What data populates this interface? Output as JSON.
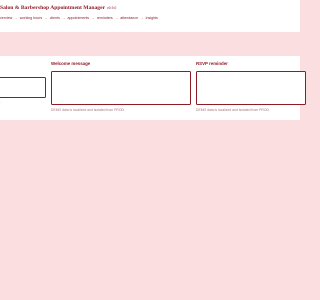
{
  "app": {
    "title": "Salon & Barbershop Appointment Manager",
    "version": "v0.9.0"
  },
  "nav": {
    "items": [
      "verview",
      "working hours",
      "clients",
      "appointments",
      "reminders",
      "attendance",
      "insights"
    ],
    "separator": "→"
  },
  "form": {
    "left_field": {
      "hint": "."
    },
    "welcome": {
      "label": "Welcome message",
      "value": "",
      "hint": "DEMO data is localized and isolated from PROD."
    },
    "rsvp": {
      "label": "RSVP reminder",
      "value": "",
      "hint": "DEMO data is localized and isolated from PROD."
    }
  },
  "colors": {
    "background": "#fbdfe0",
    "accent": "#8e1b25",
    "surface": "#ffffff",
    "hint": "#a9787c"
  }
}
